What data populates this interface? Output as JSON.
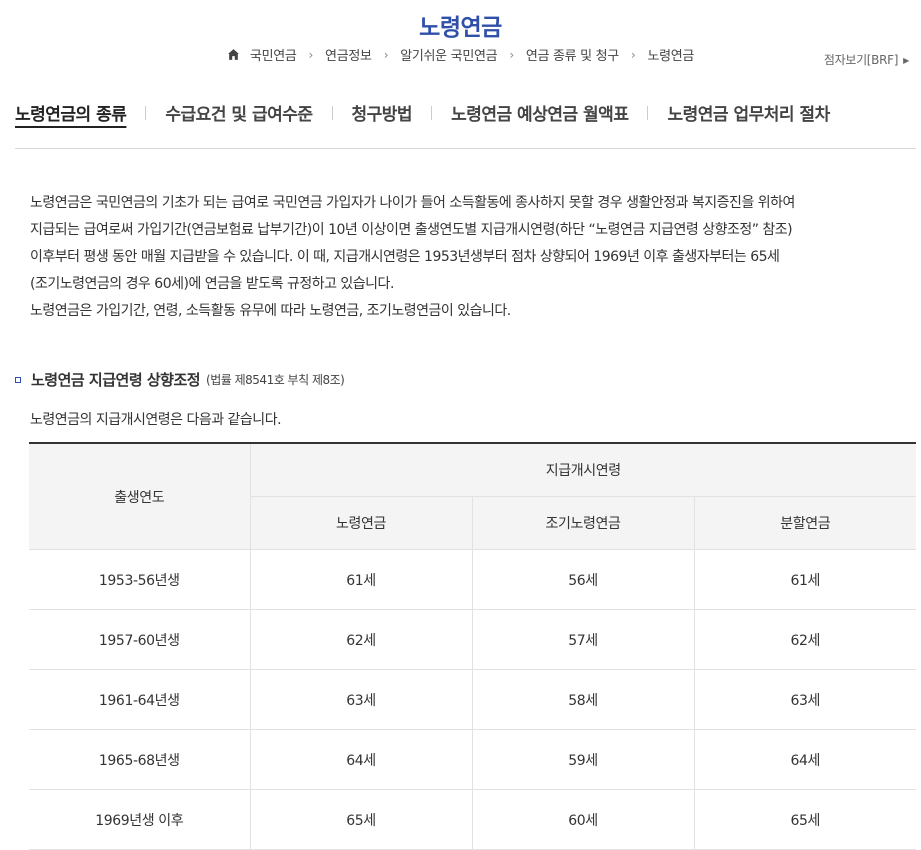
{
  "header": {
    "title": "노령연금",
    "braille_link": "점자보기[BRF]"
  },
  "breadcrumb": [
    "국민연금",
    "연금정보",
    "알기쉬운 국민연금",
    "연금 종류 및 청구",
    "노령연금"
  ],
  "tabs": [
    {
      "label": "노령연금의 종류",
      "active": true
    },
    {
      "label": "수급요건 및 급여수준",
      "active": false
    },
    {
      "label": "청구방법",
      "active": false
    },
    {
      "label": "노령연금 예상연금 월액표",
      "active": false
    },
    {
      "label": "노령연금 업무처리 절차",
      "active": false
    }
  ],
  "intro": [
    "노령연금은 국민연금의 기초가 되는 급여로 국민연금 가입자가 나이가 들어 소득활동에 종사하지 못할 경우 생활안정과 복지증진을 위하여",
    "지급되는 급여로써 가입기간(연금보험료 납부기간)이 10년 이상이면 출생연도별 지급개시연령(하단 “노령연금 지급연령 상향조정” 참조)",
    "이후부터 평생 동안 매월 지급받을 수 있습니다. 이 때, 지급개시연령은 1953년생부터 점차 상향되어 1969년 이후 출생자부터는 65세",
    "(조기노령연금의 경우 60세)에 연금을 받도록 규정하고 있습니다.",
    "노령연금은 가입기간, 연령, 소득활동 유무에 따라 노령연금, 조기노령연금이 있습니다."
  ],
  "section": {
    "title": "노령연금 지급연령 상향조정",
    "law_note": "(법률 제8541호 부칙 제8조)",
    "description": "노령연금의 지급개시연령은 다음과 같습니다."
  },
  "table": {
    "col_birth": "출생연도",
    "col_group": "지급개시연령",
    "sub_headers": [
      "노령연금",
      "조기노령연금",
      "분할연금"
    ],
    "rows": [
      {
        "birth": "1953-56년생",
        "old_age": "61세",
        "early": "56세",
        "split": "61세"
      },
      {
        "birth": "1957-60년생",
        "old_age": "62세",
        "early": "57세",
        "split": "62세"
      },
      {
        "birth": "1961-64년생",
        "old_age": "63세",
        "early": "58세",
        "split": "63세"
      },
      {
        "birth": "1965-68년생",
        "old_age": "64세",
        "early": "59세",
        "split": "64세"
      },
      {
        "birth": "1969년생 이후",
        "old_age": "65세",
        "early": "60세",
        "split": "65세"
      }
    ]
  },
  "colors": {
    "accent": "#2f4fa8",
    "text": "#333333",
    "header_bg": "#f4f4f4",
    "border": "#e2e2e2"
  }
}
